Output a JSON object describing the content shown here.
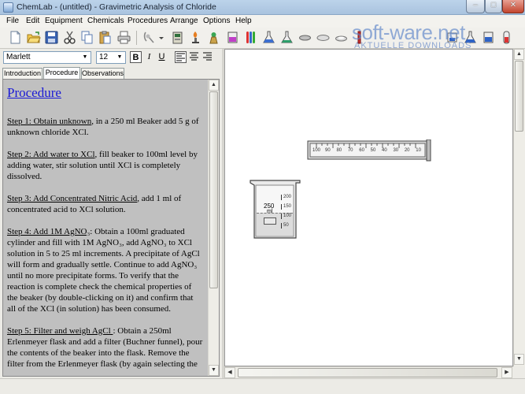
{
  "window": {
    "title": "ChemLab - (untitled) - Gravimetric Analysis of Chloride",
    "minimize_glyph": "–",
    "maximize_glyph": "□",
    "close_glyph": "✕"
  },
  "menu": [
    "File",
    "Edit",
    "Equipment",
    "Chemicals",
    "Procedures",
    "Arrange",
    "Options",
    "Help"
  ],
  "toolbar": {
    "icons": [
      "new-file-icon",
      "open-folder-icon",
      "save-icon",
      "cut-icon",
      "copy-icon",
      "paste-icon",
      "print-icon",
      "lab-tool-icon",
      "chevron-down-icon",
      "spectrometer-icon",
      "bunsen-burner-icon",
      "balance-icon",
      "beaker-icon",
      "test-tube-icon",
      "flask-icon",
      "erlenmeyer-icon",
      "funnel-icon",
      "watch-glass-icon",
      "dish-icon",
      "pipette-icon"
    ]
  },
  "watermark": {
    "brand": "soft-ware.net",
    "tagline": "AKTUELLE DOWNLOADS"
  },
  "format_bar": {
    "font": "Marlett",
    "size": "12",
    "bold": "B",
    "italic": "I",
    "underline": "U"
  },
  "tabs": [
    {
      "label": "Introduction",
      "active": false
    },
    {
      "label": "Procedure",
      "active": true
    },
    {
      "label": "Observations",
      "active": false
    }
  ],
  "procedure": {
    "heading": "Procedure",
    "steps": [
      {
        "title": "Step 1: Obtain unknown",
        "body": ", in a 250 ml Beaker add 5 g of unknown chloride XCl."
      },
      {
        "title": "Step 2: Add water to XCl",
        "body": ",  fill beaker to 100ml level by adding water, stir solution until XCl is completely dissolved."
      },
      {
        "title": "Step 3: Add Concentrated Nitric Acid",
        "body": ", add 1 ml of concentrated acid to XCl solution."
      },
      {
        "title": "Step 4: Add 1M AgNO₃",
        "body": ":  Obtain a 100ml graduated cylinder and fill with 1M AgNO₃, add AgNO₃ to XCl solution in 5 to 25 ml increments. A precipitate of AgCl will form and gradually settle. Continue to add AgNO₃ until no more precipitate forms. To verify that the reaction is complete check the chemical properties of the beaker (by double-clicking on it) and confirm that all of the XCl (in solution) has been consumed."
      },
      {
        "title": "Step 5:  Filter and weigh AgCl ",
        "body": ": Obtain  a 250ml Erlenmeyer flask and add a filter (Buchner funnel), pour the contents of the beaker into the flask. Remove the filter from the Erlenmeyer flask  (by again selecting the"
      }
    ]
  },
  "workbench": {
    "cylinder": {
      "ticks": [
        "100",
        "90",
        "80",
        "70",
        "60",
        "50",
        "40",
        "30",
        "20",
        "10"
      ]
    },
    "beaker": {
      "label": "250",
      "unit": "ml",
      "scale": [
        "200",
        "150",
        "100",
        "50"
      ],
      "liquid_level": 0.45
    }
  }
}
